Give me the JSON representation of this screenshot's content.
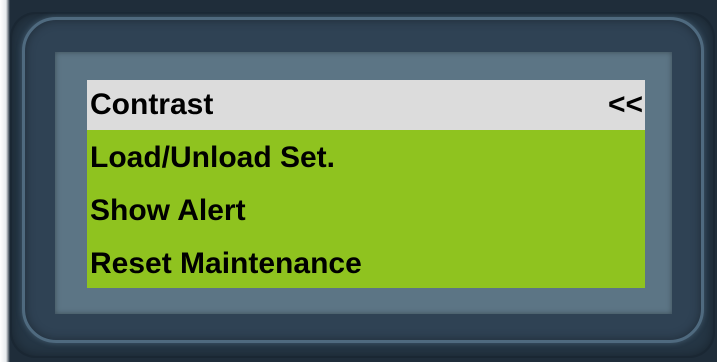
{
  "lcd_menu": {
    "items": [
      {
        "label": "Contrast",
        "selected": true
      },
      {
        "label": "Load/Unload Set.",
        "selected": false
      },
      {
        "label": "Show Alert",
        "selected": false
      },
      {
        "label": "Reset Maintenance",
        "selected": false
      }
    ],
    "cursor": "<<"
  },
  "colors": {
    "lcd_background": "#8fc31f",
    "selected_row": "#dcdcdc",
    "bezel": "#253645",
    "screen_frame": "#5c7585",
    "text": "#000000"
  }
}
